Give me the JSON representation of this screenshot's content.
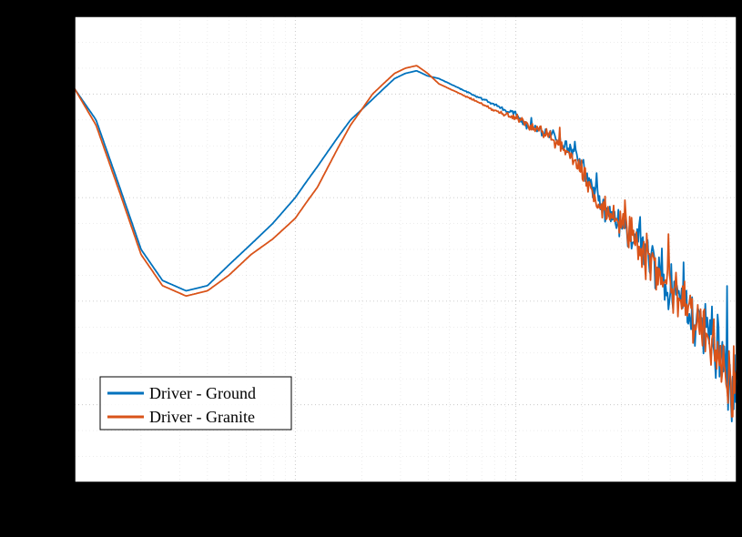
{
  "chart_data": {
    "type": "line",
    "title": "",
    "xlabel": "",
    "ylabel": "",
    "xscale": "log",
    "yscale": "linear",
    "xlim": [
      1,
      1000
    ],
    "ylim": [
      -75,
      15
    ],
    "legend_position": "lower left",
    "series": [
      {
        "name": "Driver - Ground",
        "color": "#0072BD",
        "x": [
          1,
          1.25,
          1.6,
          2,
          2.5,
          3.2,
          4,
          5,
          6.3,
          7.9,
          10,
          11.2,
          12.6,
          14.1,
          15.8,
          17.8,
          20,
          22.4,
          25.1,
          28.2,
          31.6,
          35.5,
          39.8,
          44.7,
          50.1,
          56.2,
          63.1,
          70.8,
          79.4,
          89.1,
          100,
          106,
          112,
          119,
          126,
          133,
          141,
          150,
          158,
          168,
          178,
          188,
          200,
          211,
          224,
          237,
          251,
          266,
          282,
          299,
          316,
          335,
          355,
          376,
          398,
          422,
          447,
          473,
          501,
          531,
          562,
          596,
          631,
          668,
          708,
          750,
          794,
          841,
          891,
          944,
          1000
        ],
        "y": [
          1,
          -5,
          -18,
          -30,
          -36,
          -38,
          -37,
          -33,
          -29,
          -25,
          -20,
          -17,
          -14,
          -11,
          -8,
          -5,
          -3,
          -1,
          1,
          3,
          4,
          4.5,
          3.5,
          3,
          2,
          1,
          0,
          -1,
          -2,
          -3,
          -4,
          -5,
          -6,
          -6.5,
          -7,
          -7.5,
          -8,
          -8.5,
          -9,
          -10,
          -11,
          -12,
          -14,
          -16,
          -18,
          -20,
          -22,
          -23,
          -24,
          -25,
          -26,
          -27,
          -28,
          -30,
          -32,
          -34,
          -35,
          -36,
          -37,
          -38,
          -39,
          -40,
          -42,
          -44,
          -46,
          -47,
          -48,
          -50,
          -53,
          -56,
          -58
        ]
      },
      {
        "name": "Driver - Granite",
        "color": "#D95319",
        "x": [
          1,
          1.25,
          1.6,
          2,
          2.5,
          3.2,
          4,
          5,
          6.3,
          7.9,
          10,
          11.2,
          12.6,
          14.1,
          15.8,
          17.8,
          20,
          22.4,
          25.1,
          28.2,
          31.6,
          35.5,
          39.8,
          44.7,
          50.1,
          56.2,
          63.1,
          70.8,
          79.4,
          89.1,
          100,
          106,
          112,
          119,
          126,
          133,
          141,
          150,
          158,
          168,
          178,
          188,
          200,
          211,
          224,
          237,
          251,
          266,
          282,
          299,
          316,
          335,
          355,
          376,
          398,
          422,
          447,
          473,
          501,
          531,
          562,
          596,
          631,
          668,
          708,
          750,
          794,
          841,
          891,
          944,
          1000
        ],
        "y": [
          1,
          -6,
          -19,
          -31,
          -37,
          -39,
          -38,
          -35,
          -31,
          -28,
          -24,
          -21,
          -18,
          -14,
          -10,
          -6,
          -3,
          0,
          2,
          4,
          5,
          5.5,
          4,
          2,
          1,
          0,
          -1,
          -2,
          -3,
          -4,
          -4.5,
          -5,
          -6,
          -6.5,
          -7,
          -7.5,
          -8,
          -9,
          -10,
          -11,
          -12,
          -13,
          -15,
          -17,
          -19,
          -21,
          -22,
          -23,
          -24,
          -25,
          -26,
          -27,
          -29,
          -31,
          -33,
          -34,
          -35,
          -36,
          -37,
          -38,
          -39,
          -41,
          -43,
          -45,
          -46,
          -47,
          -49,
          -51,
          -54,
          -57,
          -53
        ]
      }
    ]
  },
  "legend": {
    "items": [
      {
        "label": "Driver - Ground"
      },
      {
        "label": "Driver - Granite"
      }
    ]
  }
}
